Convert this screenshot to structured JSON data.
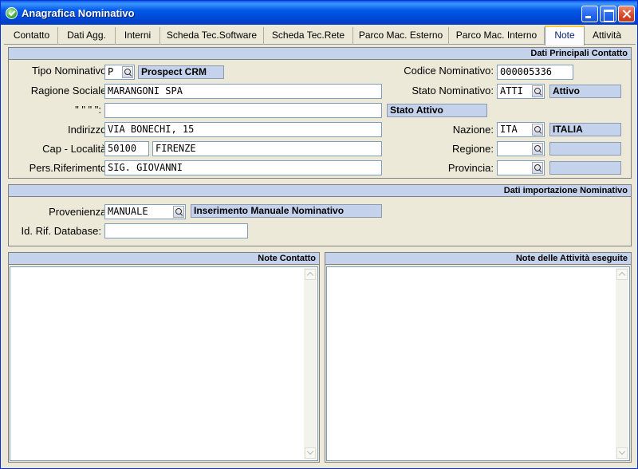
{
  "window": {
    "title": "Anagrafica Nominativo"
  },
  "tabs": [
    {
      "label": "Contatto"
    },
    {
      "label": "Dati Agg."
    },
    {
      "label": "Interni"
    },
    {
      "label": "Scheda Tec.Software"
    },
    {
      "label": "Scheda Tec.Rete"
    },
    {
      "label": "Parco Mac. Esterno"
    },
    {
      "label": "Parco Mac. Interno"
    },
    {
      "label": "Note",
      "active": true
    },
    {
      "label": "Attività"
    }
  ],
  "main_panel": {
    "header": "Dati Principali Contatto",
    "tipo_nominativo": {
      "label": "Tipo Nominativo:",
      "value": "P",
      "desc": "Prospect CRM"
    },
    "ragione_sociale": {
      "label": "Ragione Sociale:",
      "value": "MARANGONI SPA"
    },
    "ditto": {
      "label": "\"  \"  \"  \":",
      "value": ""
    },
    "stato_attivo_desc": "Stato Attivo",
    "indirizzo": {
      "label": "Indirizzo:",
      "value": "VIA BONECHI, 15"
    },
    "cap_localita": {
      "label": "Cap - Località:",
      "cap": "50100",
      "localita": "FIRENZE"
    },
    "pers_riferimento": {
      "label": "Pers.Riferimento:",
      "value": "SIG. GIOVANNI"
    },
    "codice_nominativo": {
      "label": "Codice Nominativo:",
      "value": "000005336"
    },
    "stato_nominativo": {
      "label": "Stato Nominativo:",
      "value": "ATTI",
      "desc": "Attivo"
    },
    "nazione": {
      "label": "Nazione:",
      "value": "ITA",
      "desc": "ITALIA"
    },
    "regione": {
      "label": "Regione:",
      "value": "",
      "desc": ""
    },
    "provincia": {
      "label": "Provincia:",
      "value": "",
      "desc": ""
    }
  },
  "import_panel": {
    "header": "Dati importazione Nominativo",
    "provenienza": {
      "label": "Provenienza:",
      "value": "MANUALE",
      "desc": "Inserimento Manuale Nominativo"
    },
    "id_rif_database": {
      "label": "Id. Rif. Database:",
      "value": ""
    }
  },
  "notes_contact": {
    "header": "Note Contatto",
    "text": ""
  },
  "notes_activity": {
    "header": "Note delle Attività eseguite",
    "text": ""
  },
  "colors": {
    "titlebar": "#0058e6",
    "panel_header": "#c4d2ec",
    "window_bg": "#ece9d8",
    "active_tab_accent": "#ffc83c"
  }
}
